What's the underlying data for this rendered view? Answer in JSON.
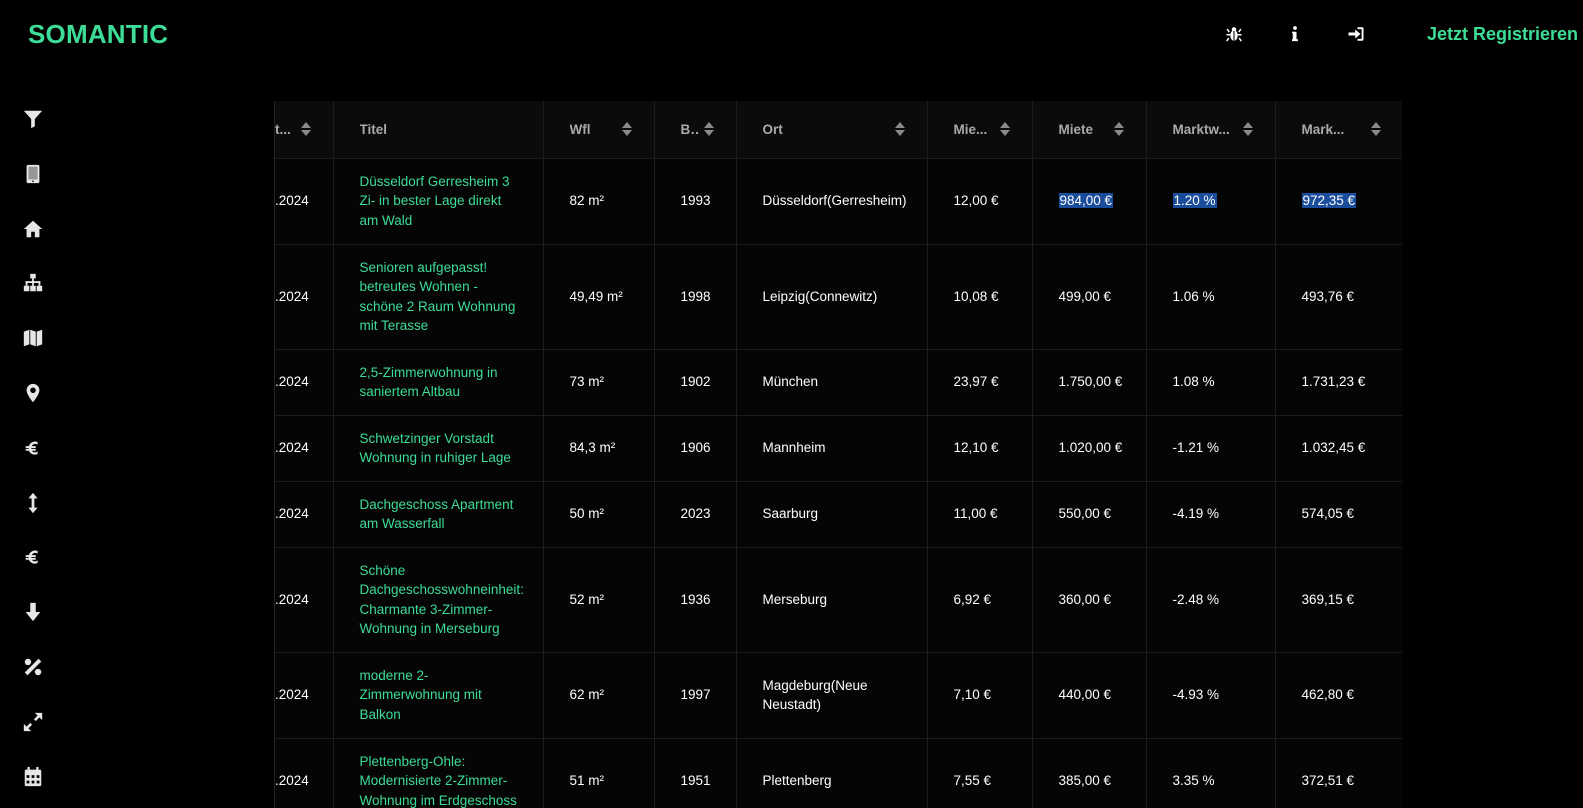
{
  "brand": "SOMANTIC",
  "header": {
    "icons": [
      "bug-icon",
      "info-icon",
      "login-icon"
    ],
    "register_label": "Jetzt Registrieren"
  },
  "colors": {
    "accent": "#3ddc97",
    "selection": "#1a4c9c",
    "background": "#000000"
  },
  "sidebar": {
    "icons": [
      "filter-icon",
      "tablet-icon",
      "home-icon",
      "sitemap-icon",
      "map-icon",
      "map-marker-icon",
      "euro-icon",
      "arrows-vertical-icon",
      "euro-sign-icon",
      "arrow-down-icon",
      "percent-icon",
      "expand-icon",
      "calendar-icon"
    ]
  },
  "table": {
    "columns": [
      "t...",
      "Titel",
      "Wfl",
      "B...",
      "Ort",
      "Mie...",
      "Miete",
      "Marktw...",
      "Mark..."
    ],
    "rows": [
      {
        "date": ".2024",
        "title": "Düsseldorf Gerresheim 3 Zi- in bester Lage direkt am Wald",
        "wfl": "82 m²",
        "year": "1993",
        "ort": "Düsseldorf(Gerresheim)",
        "miete_qm": "12,00 €",
        "miete": "984,00 €",
        "marktwert_pct": "1.20 %",
        "marktwert": "972,35 €"
      },
      {
        "date": ".2024",
        "title": "Senioren aufgepasst! betreutes Wohnen - schöne 2 Raum Wohnung mit Terasse",
        "wfl": "49,49 m²",
        "year": "1998",
        "ort": "Leipzig(Connewitz)",
        "miete_qm": "10,08 €",
        "miete": "499,00 €",
        "marktwert_pct": "1.06 %",
        "marktwert": "493,76 €"
      },
      {
        "date": ".2024",
        "title": "2,5-Zimmerwohnung in saniertem Altbau",
        "wfl": "73 m²",
        "year": "1902",
        "ort": "München",
        "miete_qm": "23,97 €",
        "miete": "1.750,00 €",
        "marktwert_pct": "1.08 %",
        "marktwert": "1.731,23 €"
      },
      {
        "date": ".2024",
        "title": "Schwetzinger Vorstadt Wohnung in ruhiger Lage",
        "wfl": "84,3 m²",
        "year": "1906",
        "ort": "Mannheim",
        "miete_qm": "12,10 €",
        "miete": "1.020,00 €",
        "marktwert_pct": "-1.21 %",
        "marktwert": "1.032,45 €"
      },
      {
        "date": ".2024",
        "title": "Dachgeschoss Apartment am Wasserfall",
        "wfl": "50 m²",
        "year": "2023",
        "ort": "Saarburg",
        "miete_qm": "11,00 €",
        "miete": "550,00 €",
        "marktwert_pct": "-4.19 %",
        "marktwert": "574,05 €"
      },
      {
        "date": ".2024",
        "title": "Schöne Dachgeschosswohneinheit: Charmante 3-Zimmer-Wohnung in Merseburg",
        "wfl": "52 m²",
        "year": "1936",
        "ort": "Merseburg",
        "miete_qm": "6,92 €",
        "miete": "360,00 €",
        "marktwert_pct": "-2.48 %",
        "marktwert": "369,15 €"
      },
      {
        "date": ".2024",
        "title": "moderne 2-Zimmerwohnung mit Balkon",
        "wfl": "62 m²",
        "year": "1997",
        "ort": "Magdeburg(Neue Neustadt)",
        "miete_qm": "7,10 €",
        "miete": "440,00 €",
        "marktwert_pct": "-4.93 %",
        "marktwert": "462,80 €"
      },
      {
        "date": ".2024",
        "title": "Plettenberg-Ohle: Modernisierte 2-Zimmer-Wohnung im Erdgeschoss",
        "wfl": "51 m²",
        "year": "1951",
        "ort": "Plettenberg",
        "miete_qm": "7,55 €",
        "miete": "385,00 €",
        "marktwert_pct": "3.35 %",
        "marktwert": "372,51 €"
      }
    ]
  }
}
